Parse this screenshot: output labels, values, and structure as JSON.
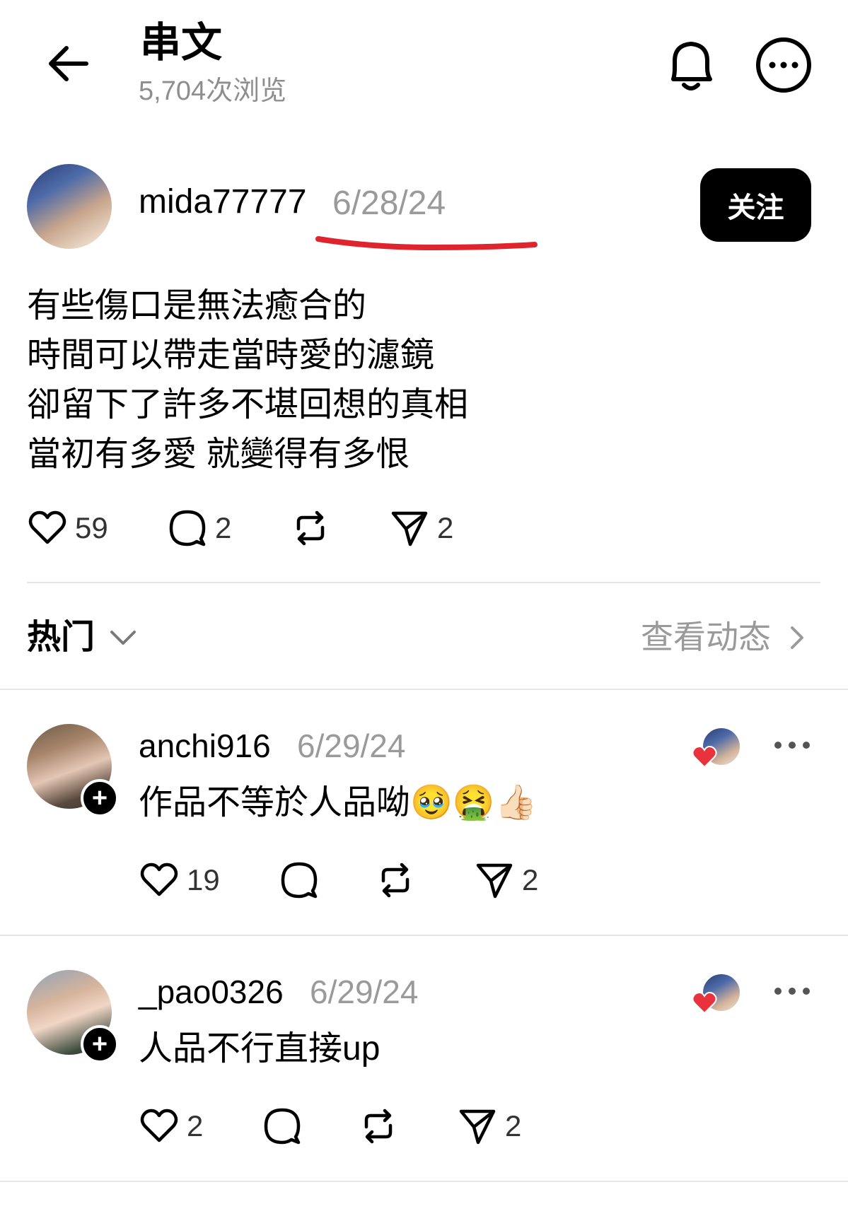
{
  "header": {
    "title": "串文",
    "view_count": "5,704次浏览"
  },
  "post": {
    "author": "mida77777",
    "date": "6/28/24",
    "follow_label": "关注",
    "lines": [
      "有些傷口是無法癒合的",
      "時間可以帶走當時愛的濾鏡",
      "卻留下了許多不堪回想的真相",
      "當初有多愛 就變得有多恨"
    ],
    "likes": "59",
    "comments": "2",
    "shares": "2"
  },
  "sort": {
    "label": "热门",
    "activity_link": "查看动态"
  },
  "comments": [
    {
      "author": "anchi916",
      "date": "6/29/24",
      "text": "作品不等於人品呦🥹🤮👍🏻",
      "likes": "19",
      "shares": "2"
    },
    {
      "author": "_pao0326",
      "date": "6/29/24",
      "text": "人品不行直接up",
      "likes": "2",
      "shares": "2"
    }
  ],
  "colors": {
    "muted_text": "#9a9a9a",
    "underline_annotation": "#e0242e",
    "heart_red": "#e8323c"
  }
}
